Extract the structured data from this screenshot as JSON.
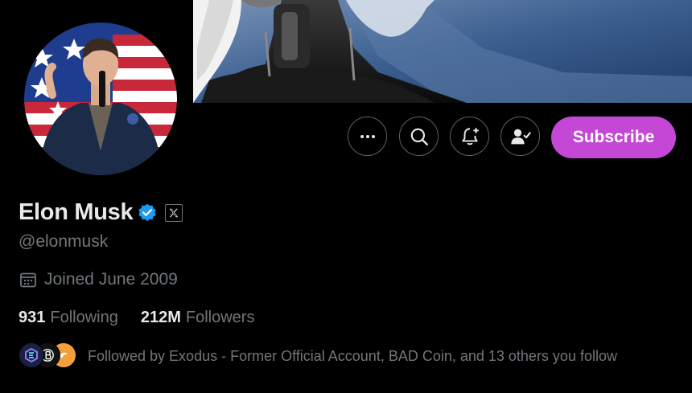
{
  "profile": {
    "name": "Elon Musk",
    "handle": "@elonmusk",
    "joined": "Joined June 2009",
    "following_count": "931",
    "following_label": "Following",
    "followers_count": "212M",
    "followers_label": "Followers",
    "followed_by": "Followed by Exodus - Former Official Account, BAD Coin, and 13 others you follow"
  },
  "actions": {
    "more_icon": "more-icon",
    "search_icon": "search-icon",
    "notify_icon": "bell-plus-icon",
    "follow_icon": "person-check-icon",
    "subscribe_label": "Subscribe"
  },
  "colors": {
    "background": "#000000",
    "subscribe": "#c547d6",
    "verified": "#1d9bf0",
    "muted_text": "#71767b"
  }
}
